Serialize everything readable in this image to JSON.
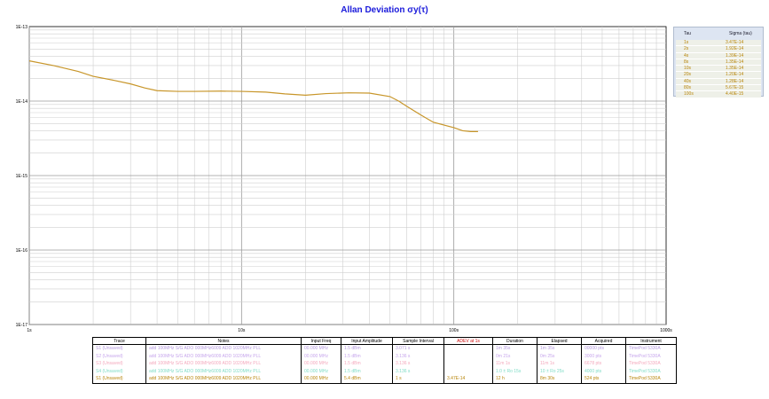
{
  "title": "Allan Deviation σy(τ)",
  "chart_data": {
    "type": "line",
    "title": "Allan Deviation σy(τ)",
    "x_scale": "log",
    "y_scale": "log",
    "xlim": [
      1,
      1000
    ],
    "ylim": [
      1e-17,
      1e-13
    ],
    "x_tick_labels": [
      {
        "value": 1,
        "label": "1s"
      },
      {
        "value": 10,
        "label": "10s"
      },
      {
        "value": 100,
        "label": "100s"
      },
      {
        "value": 1000,
        "label": "1000s"
      }
    ],
    "y_tick_labels": [
      {
        "value": 1e-13,
        "label": "1E-13"
      },
      {
        "value": 1e-14,
        "label": "1E-14"
      },
      {
        "value": 1e-15,
        "label": "1E-15"
      },
      {
        "value": 1e-16,
        "label": "1E-16"
      },
      {
        "value": 1e-17,
        "label": "1E-17"
      }
    ],
    "grid": true,
    "series": [
      {
        "color": "#c8962a",
        "x": [
          1,
          1.3,
          1.7,
          2,
          2.5,
          3,
          3.5,
          4,
          5,
          6,
          8,
          10,
          13,
          16,
          20,
          25,
          32,
          40,
          50,
          55,
          60,
          70,
          80,
          100,
          110,
          120,
          130
        ],
        "y": [
          3.47e-14,
          3e-14,
          2.5e-14,
          2.15e-14,
          1.9e-14,
          1.7e-14,
          1.5e-14,
          1.38e-14,
          1.35e-14,
          1.35e-14,
          1.36e-14,
          1.35e-14,
          1.32e-14,
          1.25e-14,
          1.2e-14,
          1.26e-14,
          1.29e-14,
          1.28e-14,
          1.15e-14,
          1e-14,
          8.5e-15,
          6.5e-15,
          5.2e-15,
          4.4e-15,
          4e-15,
          3.9e-15,
          3.9e-15
        ]
      }
    ]
  },
  "tau_table": {
    "header": {
      "tau": "Tau",
      "sigma": "Sigma (tau)"
    },
    "rows": [
      {
        "tau": "1s",
        "sigma": "3.47E-14"
      },
      {
        "tau": "2s",
        "sigma": "1.92E-14"
      },
      {
        "tau": "4s",
        "sigma": "1.39E-14"
      },
      {
        "tau": "8s",
        "sigma": "1.35E-14"
      },
      {
        "tau": "10s",
        "sigma": "1.35E-14"
      },
      {
        "tau": "20s",
        "sigma": "1.20E-14"
      },
      {
        "tau": "40s",
        "sigma": "1.28E-14"
      },
      {
        "tau": "80s",
        "sigma": "5.67E-15"
      },
      {
        "tau": "100s",
        "sigma": "4.40E-15"
      }
    ]
  },
  "trace_table": {
    "headers": [
      "Trace",
      "Notes",
      "Input Freq",
      "Input Amplitude",
      "Sample Interval",
      "ADEV at 1s",
      "Duration",
      "Elapsed",
      "Acquired",
      "Instrument"
    ],
    "rows": [
      {
        "color": "#b79be0",
        "cells": [
          "S1 (Unsaved)",
          "add 100MHz S/G ADO 000MHz6009 ADD 1020MHz PLL",
          "00.000 MHz",
          "1.5 dBm",
          "3.071 s",
          "",
          "1m 35s",
          "1m 35s",
          "00000 pts",
          "TimePod 5330A"
        ]
      },
      {
        "color": "#c7a6ec",
        "cells": [
          "S2 (Unsaved)",
          "add 100MHz S/G ADO 000MHz6009 ADD 1020MHz PLL",
          "00.000 MHz",
          "1.5 dBm",
          "3.136 s",
          "",
          "0m 21s",
          "0m 25s",
          "3000 pts",
          "TimePod 5330A"
        ]
      },
      {
        "color": "#f4a9bd",
        "cells": [
          "S3 (Unsaved)",
          "add 100MHz S/G ADO 000MHz6009 ADD 1020MHz PLL",
          "00.000 MHz",
          "1.5 dBm",
          "3.136 s",
          "",
          "11m 1s",
          "11m 1s",
          "6678 pts",
          "TimePod 5330A"
        ]
      },
      {
        "color": "#7fdcc6",
        "cells": [
          "S4 (Unsaved)",
          "add 100MHz S/G ADO 000MHz6009 ADD 1020MHz PLL",
          "00.000 MHz",
          "1.5 dBm",
          "3.136 s",
          "",
          "1.0 ± Ro 15s",
          "10 ± Ro 25s",
          "4000 pts",
          "TimePod 5330A"
        ]
      },
      {
        "color": "#b8860b",
        "cells": [
          "S1 (Unsaved)",
          "add 100MHz S/G ADO 000MHz6009 ADD 1020MHz PLL",
          "00.000 MHz",
          "5.4 dBm",
          "1 s",
          "3.47E-14",
          "12 h",
          "8m 30s",
          "524 pts",
          "TimePod 5330A"
        ]
      }
    ]
  }
}
